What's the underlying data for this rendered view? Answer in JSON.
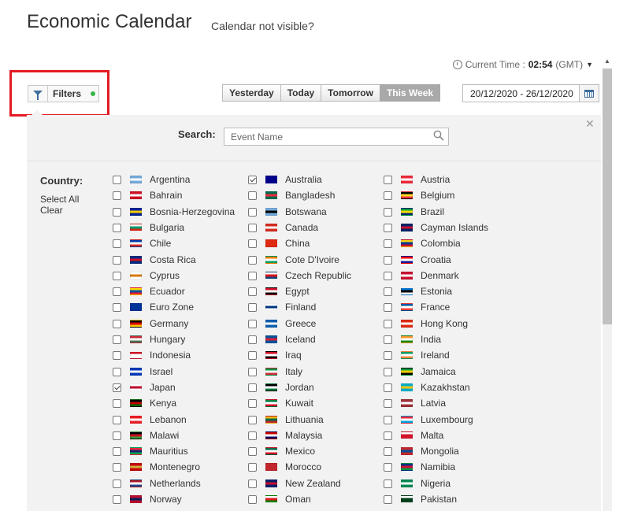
{
  "header": {
    "title": "Economic Calendar",
    "not_visible_link": "Calendar not visible?",
    "current_time_label": "Current Time :",
    "current_time_value": "02:54",
    "timezone": "(GMT)"
  },
  "toolbar": {
    "filters_label": "Filters",
    "tabs": [
      {
        "label": "Yesterday",
        "active": false
      },
      {
        "label": "Today",
        "active": false
      },
      {
        "label": "Tomorrow",
        "active": false
      },
      {
        "label": "This Week",
        "active": true
      }
    ],
    "date_range": "20/12/2020 - 26/12/2020"
  },
  "filter_panel": {
    "search_label": "Search:",
    "search_placeholder": "Event Name",
    "search_value": "",
    "country_label": "Country:",
    "select_all": "Select All",
    "clear": "Clear",
    "columns": [
      [
        {
          "name": "Argentina",
          "checked": false,
          "colors": [
            "#75aadb",
            "#ffffff",
            "#75aadb"
          ]
        },
        {
          "name": "Bahrain",
          "checked": false,
          "colors": [
            "#ce1126",
            "#ffffff",
            "#ce1126"
          ]
        },
        {
          "name": "Bosnia-Herzegovina",
          "checked": false,
          "colors": [
            "#002395",
            "#fecb00",
            "#002395"
          ]
        },
        {
          "name": "Bulgaria",
          "checked": false,
          "colors": [
            "#ffffff",
            "#00966e",
            "#d62612"
          ]
        },
        {
          "name": "Chile",
          "checked": false,
          "colors": [
            "#0039a6",
            "#ffffff",
            "#d52b1e"
          ]
        },
        {
          "name": "Costa Rica",
          "checked": false,
          "colors": [
            "#002b7f",
            "#ce1126",
            "#002b7f"
          ]
        },
        {
          "name": "Cyprus",
          "checked": false,
          "colors": [
            "#ffffff",
            "#d57800",
            "#ffffff"
          ]
        },
        {
          "name": "Ecuador",
          "checked": false,
          "colors": [
            "#ffdd00",
            "#034ea2",
            "#ed1c24"
          ]
        },
        {
          "name": "Euro Zone",
          "checked": false,
          "colors": [
            "#003399",
            "#003399",
            "#003399"
          ]
        },
        {
          "name": "Germany",
          "checked": false,
          "colors": [
            "#000000",
            "#dd0000",
            "#ffce00"
          ]
        },
        {
          "name": "Hungary",
          "checked": false,
          "colors": [
            "#ce2939",
            "#ffffff",
            "#477050"
          ]
        },
        {
          "name": "Indonesia",
          "checked": false,
          "colors": [
            "#ce1126",
            "#ffffff",
            "#ffffff"
          ]
        },
        {
          "name": "Israel",
          "checked": false,
          "colors": [
            "#0038b8",
            "#ffffff",
            "#0038b8"
          ]
        },
        {
          "name": "Japan",
          "checked": true,
          "colors": [
            "#ffffff",
            "#bc002d",
            "#ffffff"
          ]
        },
        {
          "name": "Kenya",
          "checked": false,
          "colors": [
            "#000000",
            "#bb0000",
            "#006600"
          ]
        },
        {
          "name": "Lebanon",
          "checked": false,
          "colors": [
            "#ed1c24",
            "#ffffff",
            "#ed1c24"
          ]
        },
        {
          "name": "Malawi",
          "checked": false,
          "colors": [
            "#000000",
            "#ce1126",
            "#339e35"
          ]
        },
        {
          "name": "Mauritius",
          "checked": false,
          "colors": [
            "#ea2839",
            "#1a206d",
            "#00a551"
          ]
        },
        {
          "name": "Montenegro",
          "checked": false,
          "colors": [
            "#c40308",
            "#d4af3a",
            "#c40308"
          ]
        },
        {
          "name": "Netherlands",
          "checked": false,
          "colors": [
            "#ae1c28",
            "#ffffff",
            "#21468b"
          ]
        },
        {
          "name": "Norway",
          "checked": false,
          "colors": [
            "#ba0c2f",
            "#00205b",
            "#ba0c2f"
          ]
        }
      ],
      [
        {
          "name": "Australia",
          "checked": true,
          "colors": [
            "#00008b",
            "#00008b",
            "#00008b"
          ]
        },
        {
          "name": "Bangladesh",
          "checked": false,
          "colors": [
            "#006a4e",
            "#f42a41",
            "#006a4e"
          ]
        },
        {
          "name": "Botswana",
          "checked": false,
          "colors": [
            "#75aadb",
            "#000000",
            "#75aadb"
          ]
        },
        {
          "name": "Canada",
          "checked": false,
          "colors": [
            "#d52b1e",
            "#ffffff",
            "#d52b1e"
          ]
        },
        {
          "name": "China",
          "checked": false,
          "colors": [
            "#de2910",
            "#de2910",
            "#de2910"
          ]
        },
        {
          "name": "Cote D'Ivoire",
          "checked": false,
          "colors": [
            "#f77f00",
            "#ffffff",
            "#009e60"
          ]
        },
        {
          "name": "Czech Republic",
          "checked": false,
          "colors": [
            "#ffffff",
            "#d7141a",
            "#11457e"
          ]
        },
        {
          "name": "Egypt",
          "checked": false,
          "colors": [
            "#ce1126",
            "#ffffff",
            "#000000"
          ]
        },
        {
          "name": "Finland",
          "checked": false,
          "colors": [
            "#ffffff",
            "#003580",
            "#ffffff"
          ]
        },
        {
          "name": "Greece",
          "checked": false,
          "colors": [
            "#0d5eaf",
            "#ffffff",
            "#0d5eaf"
          ]
        },
        {
          "name": "Iceland",
          "checked": false,
          "colors": [
            "#02529c",
            "#dc1e35",
            "#02529c"
          ]
        },
        {
          "name": "Iraq",
          "checked": false,
          "colors": [
            "#ce1126",
            "#ffffff",
            "#000000"
          ]
        },
        {
          "name": "Italy",
          "checked": false,
          "colors": [
            "#009246",
            "#ffffff",
            "#ce2b37"
          ]
        },
        {
          "name": "Jordan",
          "checked": false,
          "colors": [
            "#000000",
            "#ffffff",
            "#007a3d"
          ]
        },
        {
          "name": "Kuwait",
          "checked": false,
          "colors": [
            "#007a3d",
            "#ffffff",
            "#ce1126"
          ]
        },
        {
          "name": "Lithuania",
          "checked": false,
          "colors": [
            "#fdb913",
            "#006a44",
            "#c1272d"
          ]
        },
        {
          "name": "Malaysia",
          "checked": false,
          "colors": [
            "#cc0001",
            "#ffffff",
            "#010066"
          ]
        },
        {
          "name": "Mexico",
          "checked": false,
          "colors": [
            "#006847",
            "#ffffff",
            "#ce1126"
          ]
        },
        {
          "name": "Morocco",
          "checked": false,
          "colors": [
            "#c1272d",
            "#c1272d",
            "#c1272d"
          ]
        },
        {
          "name": "New Zealand",
          "checked": false,
          "colors": [
            "#012169",
            "#c8102e",
            "#012169"
          ]
        },
        {
          "name": "Oman",
          "checked": false,
          "colors": [
            "#ffffff",
            "#db161b",
            "#008000"
          ]
        }
      ],
      [
        {
          "name": "Austria",
          "checked": false,
          "colors": [
            "#ed2939",
            "#ffffff",
            "#ed2939"
          ]
        },
        {
          "name": "Belgium",
          "checked": false,
          "colors": [
            "#000000",
            "#fdda24",
            "#ef3340"
          ]
        },
        {
          "name": "Brazil",
          "checked": false,
          "colors": [
            "#009c3b",
            "#ffdf00",
            "#002776"
          ]
        },
        {
          "name": "Cayman Islands",
          "checked": false,
          "colors": [
            "#012169",
            "#c8102e",
            "#012169"
          ]
        },
        {
          "name": "Colombia",
          "checked": false,
          "colors": [
            "#fcd116",
            "#003893",
            "#ce1126"
          ]
        },
        {
          "name": "Croatia",
          "checked": false,
          "colors": [
            "#ff0000",
            "#ffffff",
            "#171796"
          ]
        },
        {
          "name": "Denmark",
          "checked": false,
          "colors": [
            "#c8102e",
            "#ffffff",
            "#c8102e"
          ]
        },
        {
          "name": "Estonia",
          "checked": false,
          "colors": [
            "#0072ce",
            "#000000",
            "#ffffff"
          ]
        },
        {
          "name": "France",
          "checked": false,
          "colors": [
            "#0055a4",
            "#ffffff",
            "#ef4135"
          ]
        },
        {
          "name": "Hong Kong",
          "checked": false,
          "colors": [
            "#de2910",
            "#ffffff",
            "#de2910"
          ]
        },
        {
          "name": "India",
          "checked": false,
          "colors": [
            "#ff9933",
            "#ffffff",
            "#138808"
          ]
        },
        {
          "name": "Ireland",
          "checked": false,
          "colors": [
            "#169b62",
            "#ffffff",
            "#ff883e"
          ]
        },
        {
          "name": "Jamaica",
          "checked": false,
          "colors": [
            "#009b3a",
            "#fed100",
            "#000000"
          ]
        },
        {
          "name": "Kazakhstan",
          "checked": false,
          "colors": [
            "#00afca",
            "#fec50c",
            "#00afca"
          ]
        },
        {
          "name": "Latvia",
          "checked": false,
          "colors": [
            "#9e3039",
            "#ffffff",
            "#9e3039"
          ]
        },
        {
          "name": "Luxembourg",
          "checked": false,
          "colors": [
            "#ed2939",
            "#ffffff",
            "#00a1de"
          ]
        },
        {
          "name": "Malta",
          "checked": false,
          "colors": [
            "#ffffff",
            "#cf142b",
            "#cf142b"
          ]
        },
        {
          "name": "Mongolia",
          "checked": false,
          "colors": [
            "#c4272f",
            "#015197",
            "#c4272f"
          ]
        },
        {
          "name": "Namibia",
          "checked": false,
          "colors": [
            "#003580",
            "#d21034",
            "#009543"
          ]
        },
        {
          "name": "Nigeria",
          "checked": false,
          "colors": [
            "#008751",
            "#ffffff",
            "#008751"
          ]
        },
        {
          "name": "Pakistan",
          "checked": false,
          "colors": [
            "#ffffff",
            "#01411c",
            "#01411c"
          ]
        }
      ]
    ]
  },
  "colors": {
    "highlight": "#e31b23",
    "status_dot": "#3ab54a",
    "active_tab": "#a9a9a9",
    "panel_bg": "#f2f2f2",
    "icon_blue": "#3d6e9c"
  }
}
